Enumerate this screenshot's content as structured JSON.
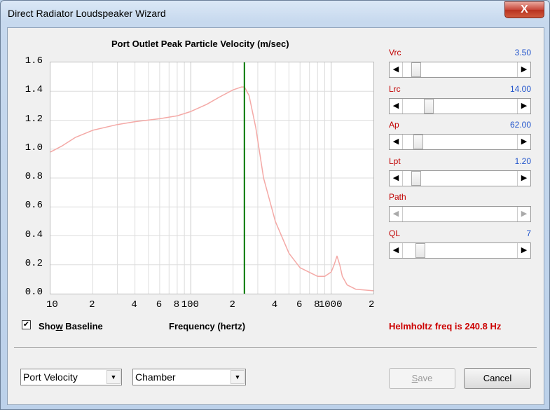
{
  "window": {
    "title": "Direct Radiator Loudspeaker Wizard",
    "close_glyph": "X"
  },
  "chart": {
    "title": "Port Outlet Peak Particle Velocity (m/sec)",
    "xlabel": "Frequency (hertz)",
    "yticks": [
      "1.6",
      "1.4",
      "1.2",
      "1.0",
      "0.8",
      "0.6",
      "0.4",
      "0.2",
      "0.0"
    ],
    "xticks": [
      "10",
      "2",
      "4",
      "6",
      "8",
      "100",
      "2",
      "4",
      "6",
      "8",
      "1000",
      "2"
    ]
  },
  "chart_data": {
    "type": "line",
    "title": "Port Outlet Peak Particle Velocity (m/sec)",
    "xlabel": "Frequency (hertz)",
    "ylabel": "",
    "x_scale": "log",
    "xlim": [
      10,
      2000
    ],
    "ylim": [
      0,
      1.6
    ],
    "grid": true,
    "series": [
      {
        "color": "#f4a9a6",
        "x": [
          10,
          12,
          15,
          20,
          30,
          40,
          60,
          80,
          100,
          130,
          160,
          200,
          230,
          241,
          260,
          290,
          330,
          400,
          500,
          600,
          800,
          900,
          1000,
          1050,
          1100,
          1150,
          1200,
          1300,
          1500,
          2000
        ],
        "y": [
          0.98,
          1.02,
          1.08,
          1.13,
          1.17,
          1.19,
          1.21,
          1.23,
          1.26,
          1.31,
          1.36,
          1.41,
          1.43,
          1.43,
          1.37,
          1.15,
          0.8,
          0.5,
          0.28,
          0.18,
          0.12,
          0.12,
          0.15,
          0.2,
          0.26,
          0.2,
          0.12,
          0.06,
          0.03,
          0.02
        ]
      }
    ],
    "markers": [
      {
        "x": 240.8,
        "color": "#007700"
      }
    ]
  },
  "show_baseline": {
    "label_pre": "Sho",
    "label_key": "w",
    "label_post": " Baseline",
    "checked": true
  },
  "helmholtz": {
    "text": "Helmholtz freq is 240.8 Hz"
  },
  "params": [
    {
      "label": "Vrc",
      "value": "3.50",
      "pos": 0.08,
      "enabled": true
    },
    {
      "label": "Lrc",
      "value": "14.00",
      "pos": 0.2,
      "enabled": true
    },
    {
      "label": "Ap",
      "value": "62.00",
      "pos": 0.1,
      "enabled": true
    },
    {
      "label": "Lpt",
      "value": "1.20",
      "pos": 0.08,
      "enabled": true
    },
    {
      "label": "Path",
      "value": "",
      "pos": 0.0,
      "enabled": false
    },
    {
      "label": "QL",
      "value": "7",
      "pos": 0.12,
      "enabled": true
    }
  ],
  "selectors": {
    "view": "Port Velocity",
    "location": "Chamber"
  },
  "buttons": {
    "save_pre": "",
    "save_key": "S",
    "save_post": "ave",
    "cancel": "Cancel"
  },
  "icons": {
    "left_arrow": "◀",
    "right_arrow": "▶",
    "dropdown": "▼",
    "check": "✔"
  }
}
